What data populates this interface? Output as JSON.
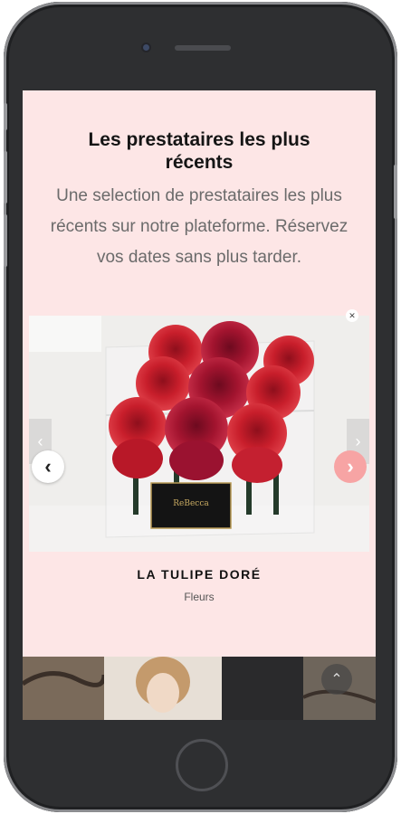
{
  "section": {
    "title": "Les prestataires les plus récents",
    "subtitle": "Une selection de prestataires les plus récents sur notre plateforme. Réservez vos dates sans plus tarder."
  },
  "carousel": {
    "prev_icon": "chevron-left-icon",
    "next_icon": "chevron-right-icon",
    "prev_glyph": "‹",
    "next_glyph": "›",
    "current": {
      "name": "LA TULIPE DORÉ",
      "category": "Fleurs",
      "image_box_label": "ReBecca"
    }
  },
  "scroll_top": {
    "icon": "chevron-up-icon",
    "glyph": "⌃"
  },
  "colors": {
    "screen_bg": "#fde6e6",
    "next_button": "#f7a4a4",
    "rose_red": "#c81e2b"
  }
}
